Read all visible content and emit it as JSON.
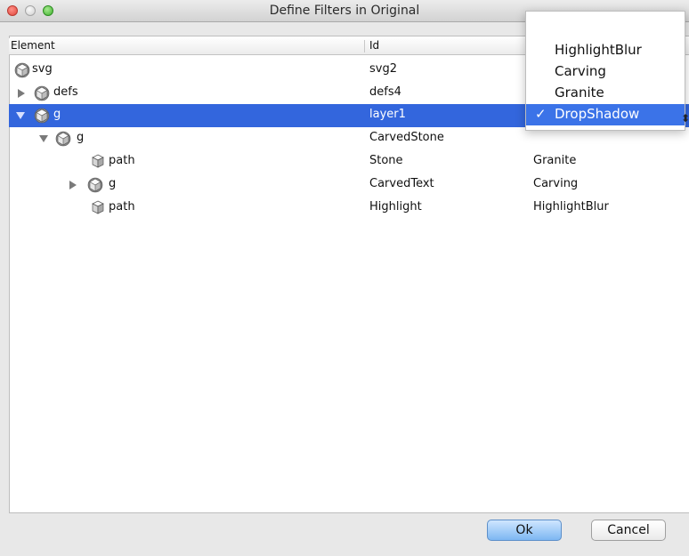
{
  "window": {
    "title": "Define Filters in Original"
  },
  "columns": {
    "element": "Element",
    "id": "Id"
  },
  "rows": [
    {
      "element": "svg",
      "id": "svg2",
      "filter": "",
      "disclosure": "none",
      "icon": "gear-cube-icon"
    },
    {
      "element": "defs",
      "id": "defs4",
      "filter": "",
      "disclosure": "collapsed",
      "icon": "gear-cube-icon"
    },
    {
      "element": "g",
      "id": "layer1",
      "filter": "DropShadow",
      "disclosure": "expanded",
      "icon": "gear-cube-icon",
      "selected": true
    },
    {
      "element": "g",
      "id": "CarvedStone",
      "filter": "",
      "disclosure": "expanded",
      "icon": "gear-cube-icon"
    },
    {
      "element": "path",
      "id": "Stone",
      "filter": "Granite",
      "disclosure": "none",
      "icon": "cube-icon"
    },
    {
      "element": "g",
      "id": "CarvedText",
      "filter": "Carving",
      "disclosure": "collapsed",
      "icon": "gear-cube-icon"
    },
    {
      "element": "path",
      "id": "Highlight",
      "filter": "HighlightBlur",
      "disclosure": "none",
      "icon": "cube-icon"
    }
  ],
  "filter_menu": {
    "options": [
      "HighlightBlur",
      "Carving",
      "Granite",
      "DropShadow"
    ],
    "selected": "DropShadow",
    "check_mark": "✓"
  },
  "buttons": {
    "ok": "Ok",
    "cancel": "Cancel"
  },
  "colors": {
    "selection": "#3366dd",
    "menu_selection": "#3b73e8"
  }
}
